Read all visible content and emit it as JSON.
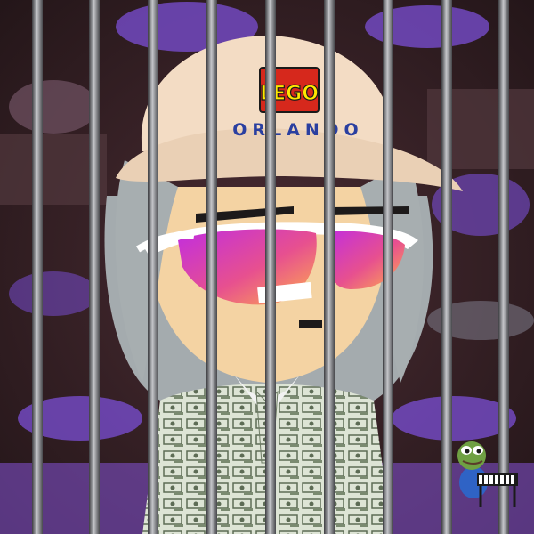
{
  "scene": {
    "title": "",
    "background": {
      "primary": "#3a2328",
      "accent_purple": "#7b4fd6",
      "accent_dark": "#1e1417"
    },
    "avatar": {
      "skin": "#f4d3a3",
      "hair": "#a7aeb0",
      "cap_color": "#f3dcc4",
      "cap_logo": {
        "brand_text": "LEGO",
        "location_text": "ORLANDO",
        "logo_bg": "#d6281c",
        "logo_text": "#ffe600"
      },
      "glasses": {
        "frame": "#ffffff",
        "lens_gradient": [
          "#d82fd0",
          "#ff9a4d"
        ]
      },
      "suit_pattern": "money-print",
      "suit_color": "#dbe3d2"
    },
    "bars": {
      "color": "#5f6064",
      "highlight": "#b5b6ba",
      "count": 9
    },
    "sticker": {
      "name": "frog-at-keyboard",
      "frog_color": "#6fa043",
      "shirt_color": "#2f63c5"
    }
  }
}
